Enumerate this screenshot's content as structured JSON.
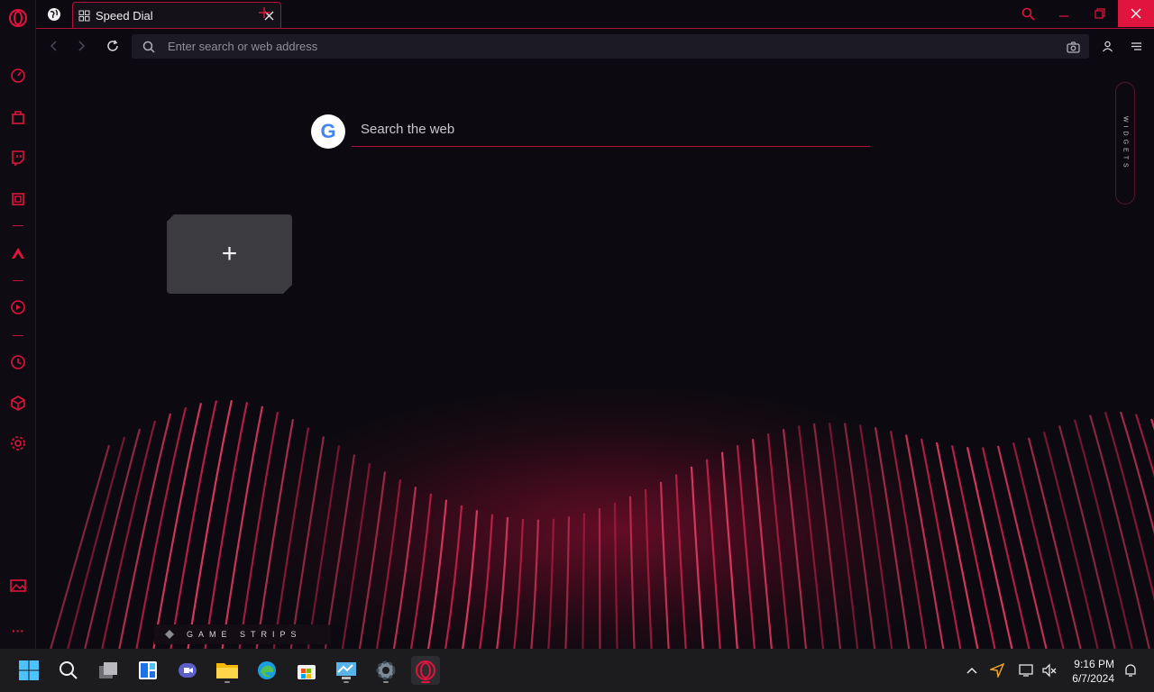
{
  "browser": {
    "tab": {
      "label": "Speed Dial"
    },
    "address": {
      "placeholder": "Enter search or web address"
    }
  },
  "speed_dial": {
    "search_placeholder": "Search the web",
    "google_letter": "G",
    "add_tile_symbol": "+",
    "widgets_label": "WIDGETS",
    "game_strips_label": "GAME STRIPS"
  },
  "sidebar": {
    "more_label": "···"
  },
  "taskbar": {
    "time": "9:16 PM",
    "date": "6/7/2024"
  },
  "colors": {
    "accent": "#e0143c",
    "background": "#0c0a10",
    "taskbar": "#1c1c1f"
  }
}
